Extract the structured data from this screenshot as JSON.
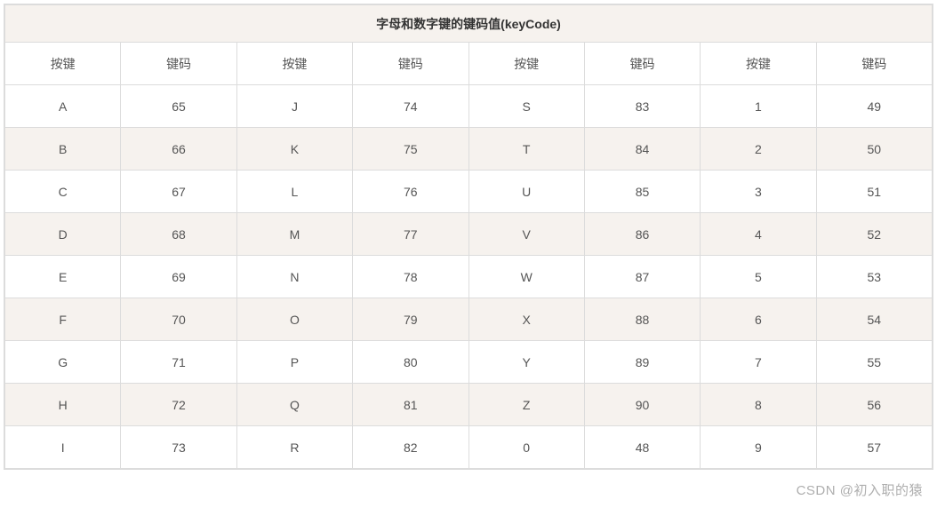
{
  "title": "字母和数字键的键码值(keyCode)",
  "columns": [
    "按键",
    "键码",
    "按键",
    "键码",
    "按键",
    "键码",
    "按键",
    "键码"
  ],
  "rows": [
    [
      "A",
      "65",
      "J",
      "74",
      "S",
      "83",
      "1",
      "49"
    ],
    [
      "B",
      "66",
      "K",
      "75",
      "T",
      "84",
      "2",
      "50"
    ],
    [
      "C",
      "67",
      "L",
      "76",
      "U",
      "85",
      "3",
      "51"
    ],
    [
      "D",
      "68",
      "M",
      "77",
      "V",
      "86",
      "4",
      "52"
    ],
    [
      "E",
      "69",
      "N",
      "78",
      "W",
      "87",
      "5",
      "53"
    ],
    [
      "F",
      "70",
      "O",
      "79",
      "X",
      "88",
      "6",
      "54"
    ],
    [
      "G",
      "71",
      "P",
      "80",
      "Y",
      "89",
      "7",
      "55"
    ],
    [
      "H",
      "72",
      "Q",
      "81",
      "Z",
      "90",
      "8",
      "56"
    ],
    [
      "I",
      "73",
      "R",
      "82",
      "0",
      "48",
      "9",
      "57"
    ]
  ],
  "watermark": "CSDN @初入职的猿"
}
